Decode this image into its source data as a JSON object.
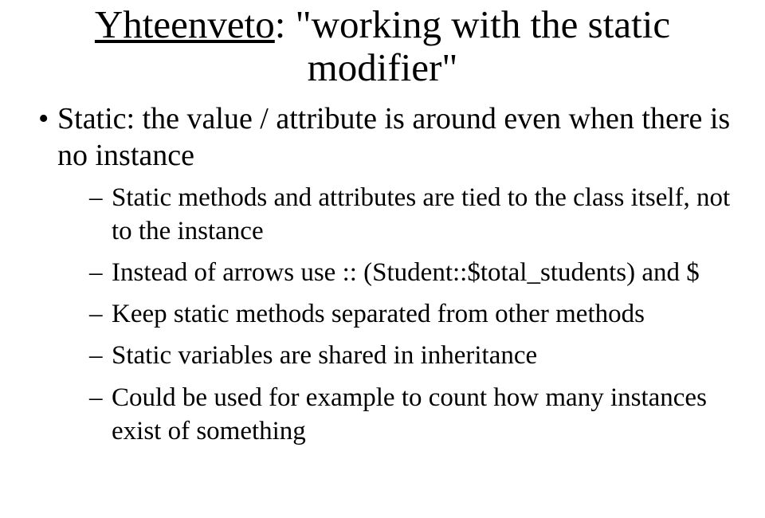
{
  "title_under": "Yhteenveto",
  "title_rest": ": \"working with the static modifier\"",
  "bullet_main": "Static: the value / attribute is around even when there is no instance",
  "sub_items": [
    "Static methods and attributes are tied to the class itself, not to the instance",
    "Instead of arrows use :: (Student::$total_students) and $",
    "Keep static methods separated from other methods",
    "Static variables are shared in inheritance",
    "Could be used for example to count how many instances exist of something"
  ]
}
